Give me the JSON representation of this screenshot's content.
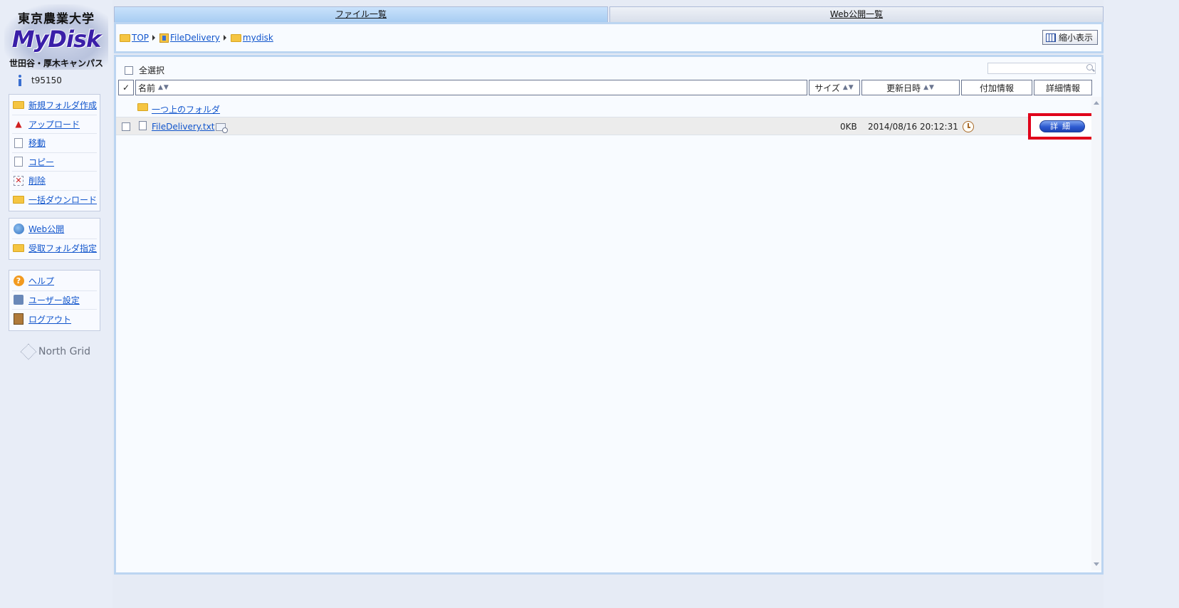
{
  "sidebar": {
    "logo": {
      "university": "東京農業大学",
      "brand": "MyDisk",
      "campus": "世田谷・厚木キャンパス"
    },
    "user": {
      "name": "t95150"
    },
    "menu_group1": [
      {
        "label": "新規フォルダ作成",
        "icon": "new-folder-icon"
      },
      {
        "label": "アップロード",
        "icon": "upload-icon"
      },
      {
        "label": "移動",
        "icon": "move-icon"
      },
      {
        "label": "コピー",
        "icon": "copy-icon"
      },
      {
        "label": "削除",
        "icon": "delete-icon"
      },
      {
        "label": "一括ダウンロード",
        "icon": "bulk-download-icon"
      }
    ],
    "menu_group2": [
      {
        "label": "Web公開",
        "icon": "globe-icon"
      },
      {
        "label": "受取フォルダ指定",
        "icon": "receive-folder-icon"
      }
    ],
    "menu_group3": [
      {
        "label": "ヘルプ",
        "icon": "help-icon"
      },
      {
        "label": "ユーザー設定",
        "icon": "user-settings-icon"
      },
      {
        "label": "ログアウト",
        "icon": "logout-icon"
      }
    ],
    "vendor": "North Grid"
  },
  "tabs": [
    {
      "label": "ファイル一覧",
      "active": true
    },
    {
      "label": "Web公開一覧",
      "active": false
    }
  ],
  "breadcrumb": [
    {
      "label": "TOP",
      "icon": "folder-icon"
    },
    {
      "label": "FileDelivery",
      "icon": "file-delivery-folder-icon"
    },
    {
      "label": "mydisk",
      "icon": "folder-icon"
    }
  ],
  "toolbar": {
    "shrink_label": "縮小表示"
  },
  "list": {
    "select_all_label": "全選択",
    "search_placeholder": "",
    "columns": {
      "check": "✓",
      "name": "名前",
      "size": "サイズ",
      "modified": "更新日時",
      "extra": "付加情報",
      "details": "詳細情報"
    },
    "sort_marks": "▲▼",
    "parent_folder_label": "一つ上のフォルダ",
    "rows": [
      {
        "name": "FileDelivery.txt",
        "size": "0KB",
        "modified": "2014/08/16 20:12:31",
        "detail_button": "詳細"
      }
    ]
  },
  "colors": {
    "accent_blue": "#bcd5f1",
    "highlight_red": "#e0001a",
    "link": "#1155cc"
  }
}
